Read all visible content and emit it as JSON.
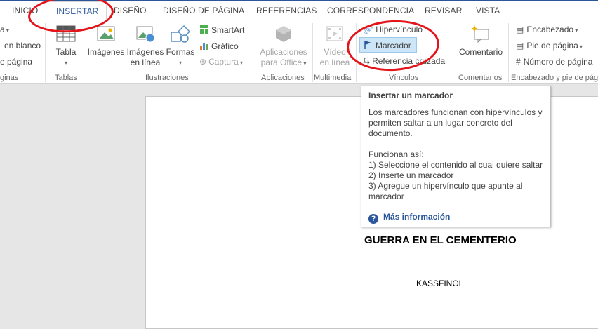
{
  "tabs": [
    {
      "label": "INICIO"
    },
    {
      "label": "INSERTAR"
    },
    {
      "label": "DISEÑO"
    },
    {
      "label": "DISEÑO DE PÁGINA"
    },
    {
      "label": "REFERENCIAS"
    },
    {
      "label": "CORRESPONDENCIA"
    },
    {
      "label": "REVISAR"
    },
    {
      "label": "VISTA"
    }
  ],
  "ribbon": {
    "pages": {
      "items": [
        {
          "label": "a"
        },
        {
          "label": "en blanco"
        },
        {
          "label": "e página"
        }
      ],
      "group": "ginas"
    },
    "tables": {
      "table": "Tabla",
      "group": "Tablas"
    },
    "illustrations": {
      "images": "Imágenes",
      "online_images_1": "Imágenes",
      "online_images_2": "en línea",
      "shapes": "Formas",
      "smartart": "SmartArt",
      "chart": "Gráfico",
      "screenshot": "Captura",
      "group": "Ilustraciones"
    },
    "apps": {
      "line1": "Aplicaciones",
      "line2": "para Office",
      "group": "Aplicaciones"
    },
    "media": {
      "line1": "Vídeo",
      "line2": "en línea",
      "group": "Multimedia"
    },
    "links": {
      "hyperlink": "Hipervínculo",
      "bookmark": "Marcador",
      "crossref": "Referencia cruzada",
      "group": "Vínculos"
    },
    "comments": {
      "comment": "Comentario",
      "group": "Comentarios"
    },
    "header_footer": {
      "header": "Encabezado",
      "footer": "Pie de página",
      "page_number": "Número de página",
      "group": "Encabezado y pie de pág"
    }
  },
  "tooltip": {
    "title": "Insertar un marcador",
    "body": "Los marcadores funcionan con hipervínculos y permiten saltar a un lugar concreto del documento.\n\nFuncionan así:\n1) Seleccione el contenido al cual quiere saltar\n2) Inserte un marcador\n3) Agregue un hipervínculo que apunte al marcador",
    "help": "Más información",
    "help_glyph": "?"
  },
  "document": {
    "title": "GUERRA EN EL CEMENTERIO",
    "author": "KASSFINOL"
  },
  "colors": {
    "accent": "#2b579a",
    "annotation": "#e3141a",
    "highlight": "#cde6f7"
  }
}
